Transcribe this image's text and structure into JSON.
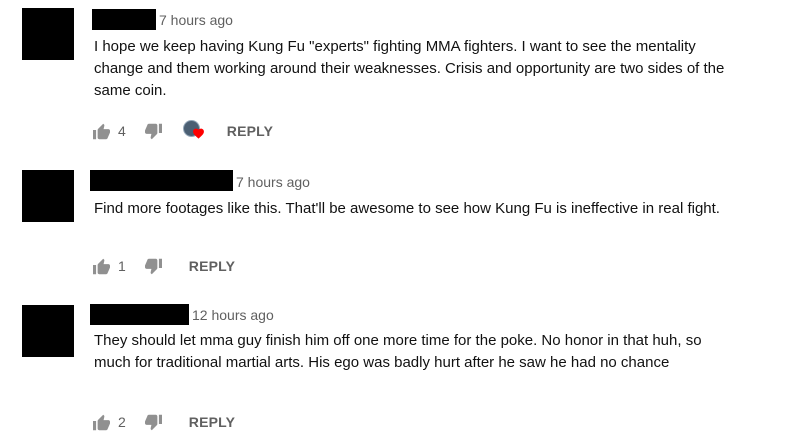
{
  "comments": [
    {
      "time": "7 hours ago",
      "text": "I hope we keep having Kung Fu \"experts\" fighting MMA fighters. I want to see the mentality change and them working around their weaknesses. Crisis and opportunity are two sides of the same coin.",
      "likes": "4",
      "reply_label": "REPLY",
      "creator_hearted": true
    },
    {
      "time": "7 hours ago",
      "text": "Find more footages like this. That'll be awesome to see how Kung Fu is ineffective in real fight.",
      "likes": "1",
      "reply_label": "REPLY",
      "creator_hearted": false
    },
    {
      "time": "12 hours ago",
      "text": "They should let mma guy finish him off one more time for the poke. No honor in that huh, so much for traditional martial arts. His ego was badly hurt after he saw he had no chance",
      "likes": "2",
      "reply_label": "REPLY",
      "creator_hearted": false
    }
  ],
  "icons": {
    "like": "thumbs-up-icon",
    "dislike": "thumbs-down-icon",
    "heart": "creator-heart-icon"
  },
  "colors": {
    "icon": "#909090",
    "meta_text": "#606060",
    "heart": "#ff0000",
    "redaction": "#000000"
  }
}
